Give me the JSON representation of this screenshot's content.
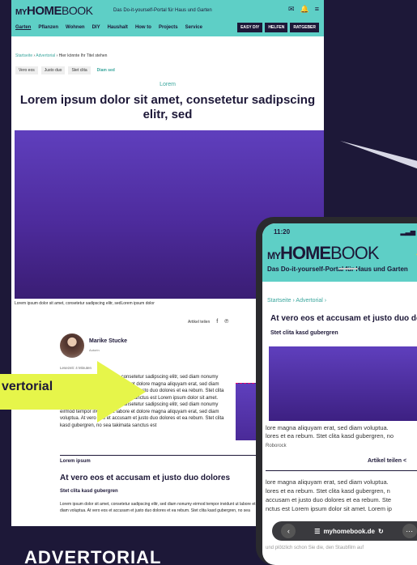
{
  "desktop": {
    "logo": {
      "my": "MY",
      "home": "HOME",
      "book": "BOOK"
    },
    "tagline": "Das Do-it-yourself-Portal für Haus und Garten",
    "nav": [
      "Garten",
      "Pflanzen",
      "Wohnen",
      "DIY",
      "Haushalt",
      "How to",
      "Projects",
      "Service"
    ],
    "nav_buttons": [
      "EASY DIY",
      "HELFEN",
      "RATGEBER"
    ],
    "breadcrumb": {
      "home": "Startseite",
      "section": "Advertorial",
      "current": "Hier könnte Ihr Titel stehen"
    },
    "tags": [
      "Vero eos",
      "Justo duo",
      "Stet clita",
      "Diam sed"
    ],
    "kicker": "Lorem",
    "title": "Lorem ipsum dolor sit amet, consetetur sadipscing elitr, sed",
    "hero_caption": "Lorem ipsum dolor sit amet, consetetur sadipscing elitr, sed",
    "hero_credit": "Lorem ipsum dolor",
    "share_label": "Artikel teilen",
    "author_name": "Marike Stucke",
    "author_role": "Autorin",
    "read_meta": "Lesezeit: 4 Minuten",
    "intro": "Lorem ipsum dolor sit amet, consetetur sadipscing elitr, sed diam nonumy eirmod tempor invidunt ut labore et dolore magna aliquyam erat, sed diam voluptua. At vero eos et accusam et justo duo dolores et ea rebum. Stet clita kasd gubergren, no sea takimata sanctus est Lorem ipsum dolor sit amet. Lorem ipsum dolor sit amet, consetetur sadipscing elitr, sed diam nonumy eirmod tempor invidunt ut labore et dolore magna aliquyam erat, sed diam voluptua. At vero eos et accusam et justo duo dolores et ea rebum. Stet clita kasd gubergren, no sea takimata sanctus est",
    "section_label": "Lorem ipsum",
    "section_title": "At vero eos et accusam et justo duo dolores",
    "section_sub": "Stet clita kasd gubergren",
    "section_body": "Lorem ipsum dolor sit amet, consetetur sadipscing elitr, sed diam nonumy eirmod tempor invidunt ut labore et dolore magna aliquyam erat, sed diam voluptua. At vero eos et accusam et justo duo dolores et ea rebum. Stet clita kasd gubergren, no sea"
  },
  "arrow_label": "vertorial",
  "bottom_title": "ADVERTORIAL",
  "phone": {
    "time": "11:20",
    "signal": "5G",
    "logo": {
      "my": "MY",
      "home": "HOME",
      "book": "BOOK"
    },
    "tagline": "Das Do-it-yourself-Portal für Haus und Garten",
    "breadcrumb": "Startseite › Advertorial ›",
    "title": "At vero eos et accusam et justo duo dolores",
    "subtitle": "Stet clita kasd gubergren",
    "text1_line1": "lore magna aliquyam erat, sed diam voluptua.",
    "text1_line2": "lores et ea rebum. Stet clita kasd gubergren, no",
    "credit": "Roborock",
    "share_label": "Artikel teilen",
    "text2_line1": "lore magna aliquyam erat, sed diam voluptua.",
    "text2_line2": "lores et ea rebum. Stet clita kasd gubergren, n",
    "text2_line3": "accusam et justo duo dolores et ea rebum. Ste",
    "text2_line4": "nctus est Lorem ipsum dolor sit amet. Lorem ip",
    "url": "myhomebook.de",
    "footer_text": "und plötzlich schon Sie die, den Staubfilm auf"
  }
}
